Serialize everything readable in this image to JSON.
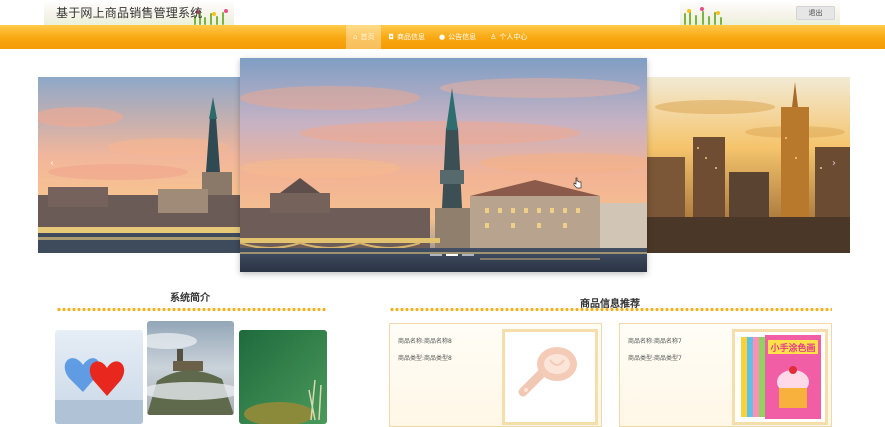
{
  "header": {
    "site_title": "基于网上商品销售管理系统",
    "logout_label": "退出"
  },
  "nav": {
    "items": [
      {
        "label": "首页",
        "icon": "home-icon",
        "active": true
      },
      {
        "label": "商品信息",
        "icon": "bag-icon",
        "active": false
      },
      {
        "label": "公告信息",
        "icon": "info-icon",
        "active": false
      },
      {
        "label": "个人中心",
        "icon": "user-icon",
        "active": false
      }
    ]
  },
  "carousel": {
    "slides": [
      "city-river-sunset",
      "city-river-sunset-center",
      "skyline-sunset"
    ],
    "active_index": 1
  },
  "intro": {
    "title": "系统简介"
  },
  "products": {
    "title": "商品信息推荐",
    "items": [
      {
        "name": "商品名称:商品名称8",
        "type": "商品类型:商品类型8",
        "image": "egg-separator"
      },
      {
        "name": "商品名称:商品名称7",
        "type": "商品类型:商品类型7",
        "image": "coloring-books",
        "cover_text": "小手涂色画"
      }
    ]
  },
  "colors": {
    "accent": "#f9a711",
    "nav_gradient_top": "#ffc94a",
    "title_text": "#333333"
  }
}
